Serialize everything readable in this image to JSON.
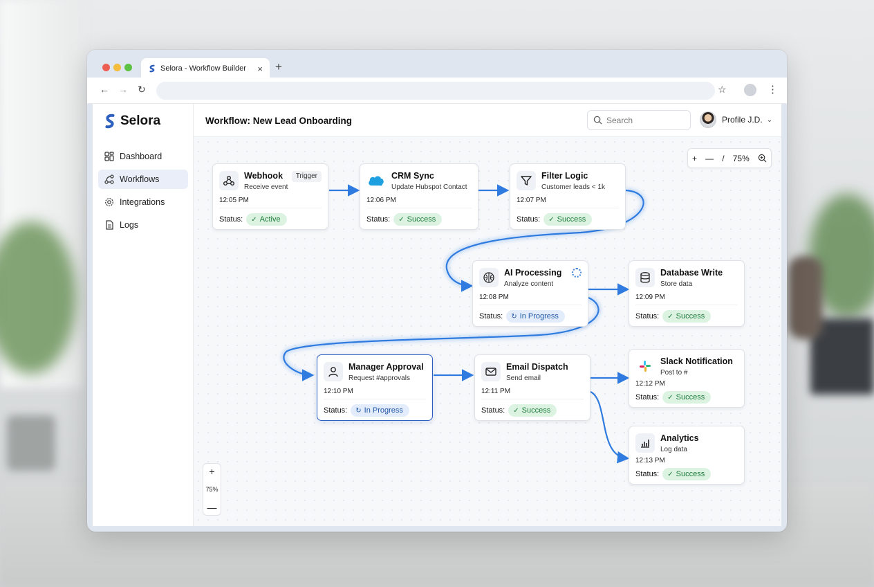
{
  "browser": {
    "tab_title": "Selora - Workflow Builder",
    "tab_close": "×",
    "new_tab": "+",
    "back": "←",
    "forward": "→",
    "reload": "↻",
    "star": "☆",
    "menu": "⋮"
  },
  "brand": {
    "name": "Selora",
    "color": "#2d5fbf"
  },
  "sidebar": {
    "items": [
      {
        "label": "Dashboard",
        "icon": "dashboard-icon",
        "active": false
      },
      {
        "label": "Workflows",
        "icon": "workflow-icon",
        "active": true
      },
      {
        "label": "Integrations",
        "icon": "gear-icon",
        "active": false
      },
      {
        "label": "Logs",
        "icon": "document-icon",
        "active": false
      }
    ]
  },
  "header": {
    "title": "Workflow: New Lead Onboarding",
    "search_placeholder": "Search",
    "profile_name": "Profile J.D."
  },
  "zoom": {
    "plus": "+",
    "minus": "—",
    "sep": "/",
    "value": "75%"
  },
  "zoom_mini": {
    "plus": "+",
    "value": "75%",
    "minus": "—"
  },
  "status_label": "Status:",
  "nodes": {
    "webhook": {
      "title": "Webhook",
      "subtitle": "Receive event",
      "time": "12:05 PM",
      "status": "Active",
      "tag": "Trigger",
      "icon": "webhook-icon"
    },
    "crm": {
      "title": "CRM Sync",
      "subtitle": "Update Hubspot Contact",
      "time": "12:06 PM",
      "status": "Success",
      "icon": "salesforce-cloud-icon"
    },
    "filter": {
      "title": "Filter Logic",
      "subtitle": "Customer leads < 1k",
      "time": "12:07 PM",
      "status": "Success",
      "icon": "funnel-icon"
    },
    "ai": {
      "title": "AI Processing",
      "subtitle": "Analyze content",
      "time": "12:08 PM",
      "status": "In Progress",
      "icon": "brain-icon"
    },
    "db": {
      "title": "Database Write",
      "subtitle": "Store data",
      "time": "12:09 PM",
      "status": "Success",
      "icon": "database-icon"
    },
    "approval": {
      "title": "Manager Approval",
      "subtitle": "Request #approvals",
      "time": "12:10 PM",
      "status": "In Progress",
      "icon": "user-icon"
    },
    "email": {
      "title": "Email Dispatch",
      "subtitle": "Send email",
      "time": "12:11 PM",
      "status": "Success",
      "icon": "mail-icon"
    },
    "slack": {
      "title": "Slack Notification",
      "subtitle": "Post to #",
      "time": "12:12 PM",
      "status": "Success",
      "icon": "slack-icon"
    },
    "analytics": {
      "title": "Analytics",
      "subtitle": "Log data",
      "time": "12:13 PM",
      "status": "Success",
      "icon": "bar-chart-icon"
    }
  },
  "colors": {
    "accent": "#2f7be0",
    "success_bg": "#dcf3e2",
    "success_fg": "#1e7a3c",
    "progress_bg": "#e2ecfb",
    "progress_fg": "#2457a8"
  }
}
